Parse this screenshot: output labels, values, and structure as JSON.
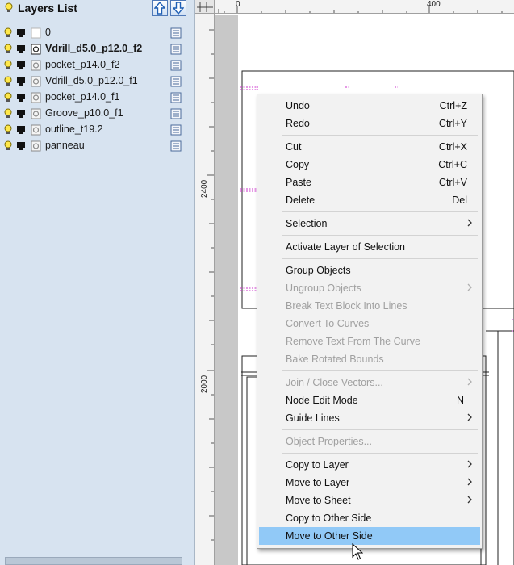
{
  "layers_panel": {
    "title": "Layers List",
    "layers": [
      {
        "name": "0",
        "active": false,
        "bulb": false,
        "lock": false
      },
      {
        "name": "Vdrill_d5.0_p12.0_f2",
        "active": true,
        "bulb": true,
        "lock": true
      },
      {
        "name": "pocket_p14.0_f2",
        "active": false,
        "bulb": true,
        "lock": true
      },
      {
        "name": "Vdrill_d5.0_p12.0_f1",
        "active": false,
        "bulb": true,
        "lock": true
      },
      {
        "name": "pocket_p14.0_f1",
        "active": false,
        "bulb": true,
        "lock": true
      },
      {
        "name": "Groove_p10.0_f1",
        "active": false,
        "bulb": true,
        "lock": true
      },
      {
        "name": "outline_t19.2",
        "active": false,
        "bulb": true,
        "lock": true
      },
      {
        "name": "panneau",
        "active": false,
        "bulb": true,
        "lock": true
      }
    ]
  },
  "rulers": {
    "top": [
      "0",
      "400"
    ],
    "left": [
      "2400",
      "2000"
    ]
  },
  "context_menu": {
    "undo": {
      "label": "Undo",
      "shortcut": "Ctrl+Z"
    },
    "redo": {
      "label": "Redo",
      "shortcut": "Ctrl+Y"
    },
    "cut": {
      "label": "Cut",
      "shortcut": "Ctrl+X"
    },
    "copy": {
      "label": "Copy",
      "shortcut": "Ctrl+C"
    },
    "paste": {
      "label": "Paste",
      "shortcut": "Ctrl+V"
    },
    "delete": {
      "label": "Delete",
      "shortcut": "Del"
    },
    "selection": {
      "label": "Selection"
    },
    "activate_layer": {
      "label": "Activate Layer of Selection"
    },
    "group_objects": {
      "label": "Group Objects"
    },
    "ungroup_objects": {
      "label": "Ungroup Objects"
    },
    "break_text": {
      "label": "Break Text Block Into Lines"
    },
    "convert_curves": {
      "label": "Convert To Curves"
    },
    "remove_text_curve": {
      "label": "Remove Text From The Curve"
    },
    "bake_rotated": {
      "label": "Bake Rotated Bounds"
    },
    "join_close": {
      "label": "Join / Close Vectors..."
    },
    "node_edit": {
      "label": "Node Edit Mode",
      "shortcut": "N"
    },
    "guide_lines": {
      "label": "Guide Lines"
    },
    "object_properties": {
      "label": "Object Properties..."
    },
    "copy_to_layer": {
      "label": "Copy to Layer"
    },
    "move_to_layer": {
      "label": "Move to Layer"
    },
    "move_to_sheet": {
      "label": "Move to Sheet"
    },
    "copy_other_side": {
      "label": "Copy to Other Side"
    },
    "move_other_side": {
      "label": "Move to Other Side"
    }
  },
  "colors": {
    "panel_bg": "#d7e3f0",
    "menu_highlight": "#91c9f7",
    "marker_magenta": "#cc33cc"
  }
}
